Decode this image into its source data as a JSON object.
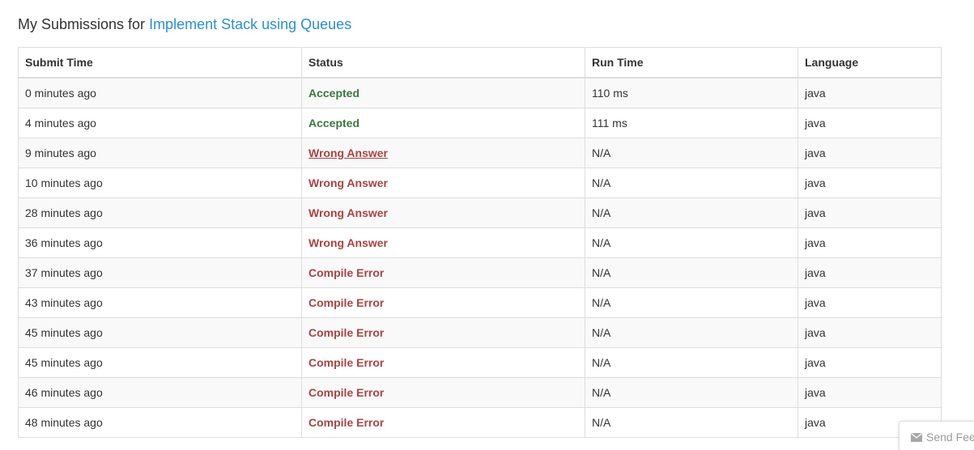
{
  "heading": {
    "prefix": "My Submissions for",
    "problem_link": "Implement Stack using Queues"
  },
  "table": {
    "headers": [
      "Submit Time",
      "Status",
      "Run Time",
      "Language"
    ],
    "rows": [
      {
        "time": "0 minutes ago",
        "status": "Accepted",
        "status_type": "accepted",
        "run_time": "110 ms",
        "language": "java"
      },
      {
        "time": "4 minutes ago",
        "status": "Accepted",
        "status_type": "accepted",
        "run_time": "111 ms",
        "language": "java"
      },
      {
        "time": "9 minutes ago",
        "status": "Wrong Answer",
        "status_type": "error",
        "run_time": "N/A",
        "language": "java"
      },
      {
        "time": "10 minutes ago",
        "status": "Wrong Answer",
        "status_type": "error",
        "run_time": "N/A",
        "language": "java"
      },
      {
        "time": "28 minutes ago",
        "status": "Wrong Answer",
        "status_type": "error",
        "run_time": "N/A",
        "language": "java"
      },
      {
        "time": "36 minutes ago",
        "status": "Wrong Answer",
        "status_type": "error",
        "run_time": "N/A",
        "language": "java"
      },
      {
        "time": "37 minutes ago",
        "status": "Compile Error",
        "status_type": "error",
        "run_time": "N/A",
        "language": "java"
      },
      {
        "time": "43 minutes ago",
        "status": "Compile Error",
        "status_type": "error",
        "run_time": "N/A",
        "language": "java"
      },
      {
        "time": "45 minutes ago",
        "status": "Compile Error",
        "status_type": "error",
        "run_time": "N/A",
        "language": "java"
      },
      {
        "time": "45 minutes ago",
        "status": "Compile Error",
        "status_type": "error",
        "run_time": "N/A",
        "language": "java"
      },
      {
        "time": "46 minutes ago",
        "status": "Compile Error",
        "status_type": "error",
        "run_time": "N/A",
        "language": "java"
      },
      {
        "time": "48 minutes ago",
        "status": "Compile Error",
        "status_type": "error",
        "run_time": "N/A",
        "language": "java"
      }
    ]
  },
  "feedback": {
    "label": "Send Feedback",
    "icon": "envelope-icon"
  },
  "colors": {
    "link": "#2a8fd6",
    "accepted": "#3c763d",
    "error": "#a94442",
    "border": "#dddddd",
    "stripe": "#f9f9f9"
  }
}
